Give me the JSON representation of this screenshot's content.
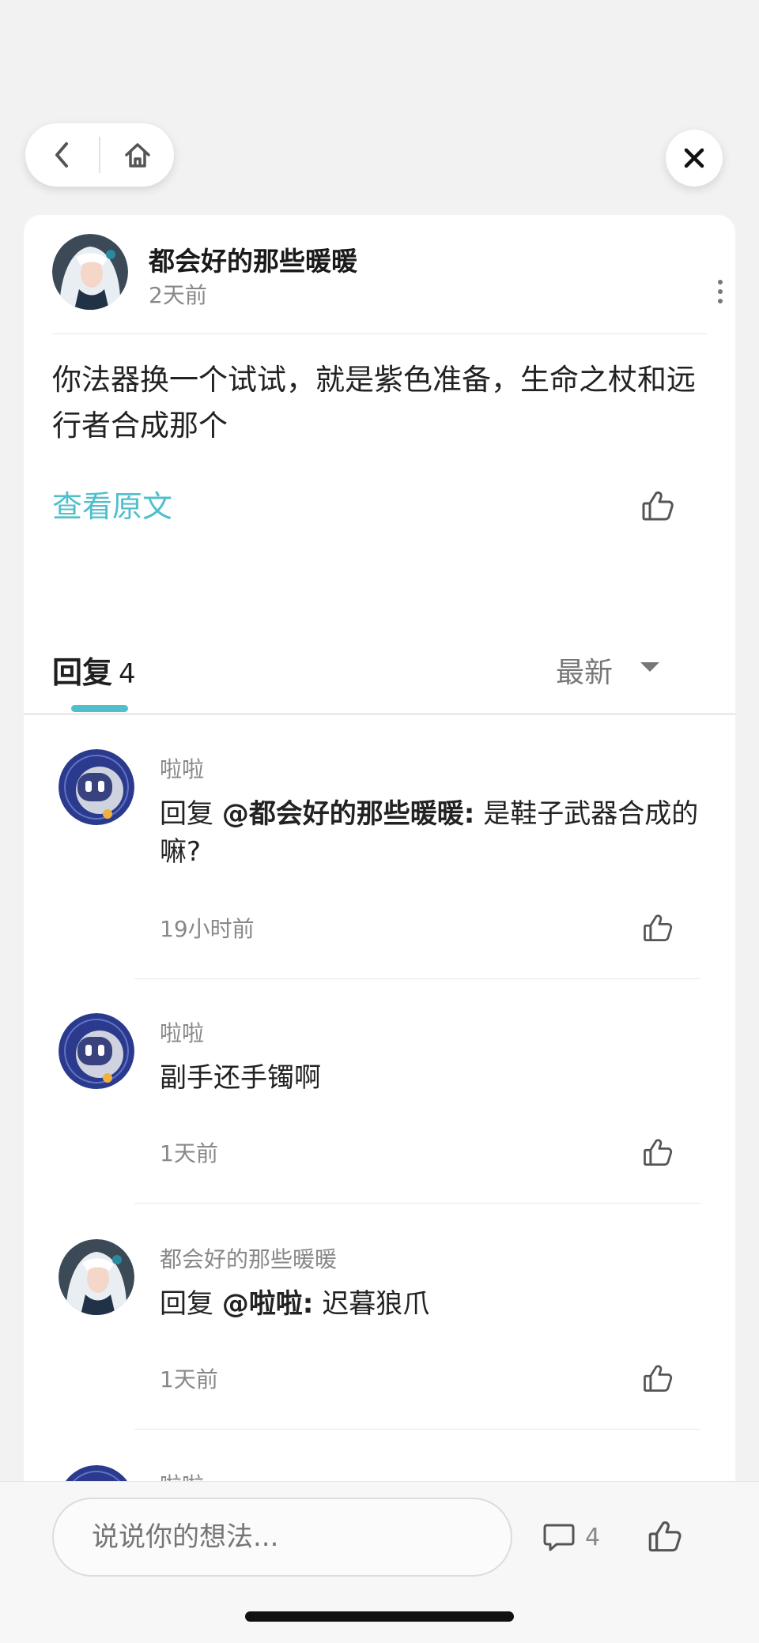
{
  "nav": {
    "back_icon": "chevron-left-icon",
    "home_icon": "home-icon",
    "close_icon": "close-icon"
  },
  "post": {
    "author": "都会好的那些暖暖",
    "time": "2天前",
    "body": "你法器换一个试试，就是紫色准备，生命之杖和远行者合成那个",
    "view_original": "查看原文"
  },
  "tabs": {
    "reply_label": "回复",
    "reply_count": "4",
    "sort_label": "最新"
  },
  "replies": [
    {
      "user": "啦啦",
      "prefix": "回复 ",
      "mention": "@都会好的那些暖暖:",
      "text": " 是鞋子武器合成的嘛?",
      "time": "19小时前"
    },
    {
      "user": "啦啦",
      "prefix": "",
      "mention": "",
      "text": "副手还手镯啊",
      "time": "1天前"
    },
    {
      "user": "都会好的那些暖暖",
      "prefix": "回复 ",
      "mention": "@啦啦:",
      "text": " 迟暮狼爪",
      "time": "1天前"
    },
    {
      "user": "啦啦"
    }
  ],
  "bottom": {
    "placeholder": "说说你的想法...",
    "comment_count": "4"
  },
  "colors": {
    "accent": "#4fbfcc",
    "background": "#f2f2f3"
  }
}
